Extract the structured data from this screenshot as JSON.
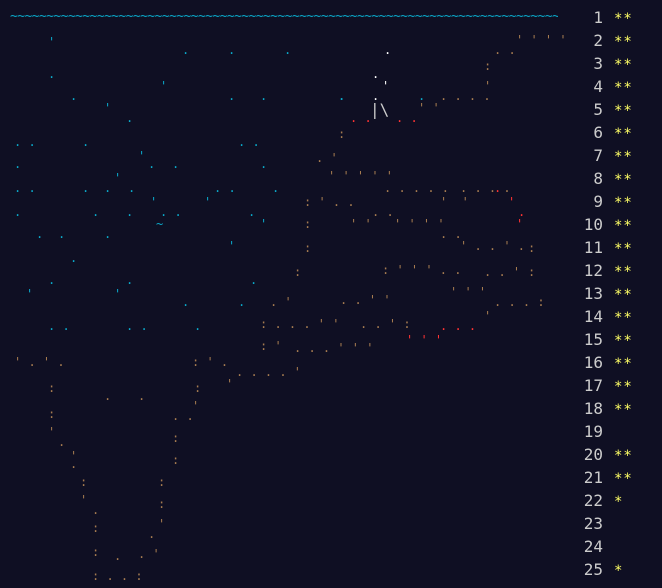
{
  "wave": "~~~~~~~~~~~~~~~~~~~~~~~~~~~~~~~~~~~~~~~~~~~~~~~~~~~~~~~~~~~~~~~~~~~~~~~~~~~~",
  "glyph": "|\\",
  "colors": {
    "background": "#0f0f23",
    "wave": "#0aa8c8",
    "gold_star": "#ffff66",
    "silver_star": "#9999cc",
    "number": "#cccccc",
    "dirt": "#a57b50",
    "red": "#ff3333",
    "blue": "#0aa8c8",
    "white": "#ffffff"
  },
  "days": [
    {
      "number": "1",
      "stars": "**"
    },
    {
      "number": "2",
      "stars": "**"
    },
    {
      "number": "3",
      "stars": "**"
    },
    {
      "number": "4",
      "stars": "**"
    },
    {
      "number": "5",
      "stars": "**"
    },
    {
      "number": "6",
      "stars": "**"
    },
    {
      "number": "7",
      "stars": "**"
    },
    {
      "number": "8",
      "stars": "**"
    },
    {
      "number": "9",
      "stars": "**"
    },
    {
      "number": "10",
      "stars": "**"
    },
    {
      "number": "11",
      "stars": "**"
    },
    {
      "number": "12",
      "stars": "**"
    },
    {
      "number": "13",
      "stars": "**"
    },
    {
      "number": "14",
      "stars": "**"
    },
    {
      "number": "15",
      "stars": "**"
    },
    {
      "number": "16",
      "stars": "**"
    },
    {
      "number": "17",
      "stars": "**"
    },
    {
      "number": "18",
      "stars": "**"
    },
    {
      "number": "19",
      "stars": ""
    },
    {
      "number": "20",
      "stars": "**"
    },
    {
      "number": "21",
      "stars": "**"
    },
    {
      "number": "22",
      "stars": "*"
    },
    {
      "number": "23",
      "stars": ""
    },
    {
      "number": "24",
      "stars": ""
    },
    {
      "number": "25",
      "stars": "*"
    }
  ]
}
